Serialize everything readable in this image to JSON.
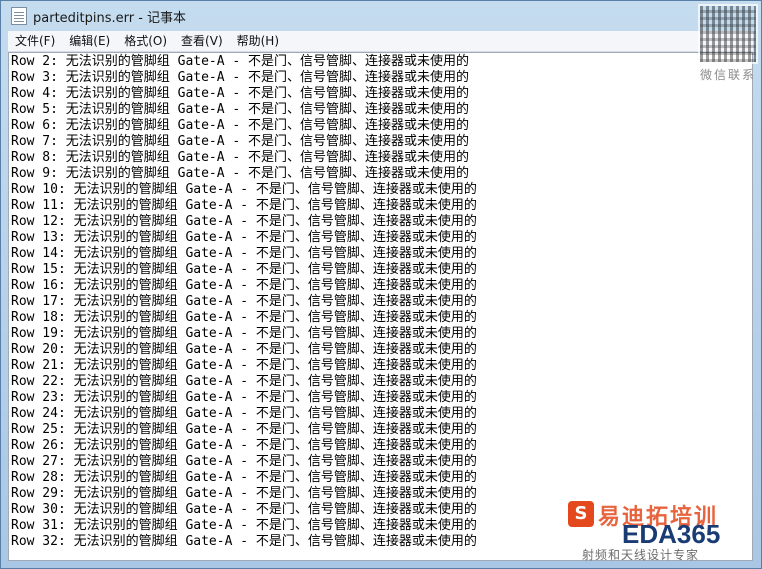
{
  "window": {
    "title": "parteditpins.err - 记事本"
  },
  "menu": [
    {
      "label": "文件(F)"
    },
    {
      "label": "编辑(E)"
    },
    {
      "label": "格式(O)"
    },
    {
      "label": "查看(V)"
    },
    {
      "label": "帮助(H)"
    }
  ],
  "lines": [
    "Row 2: 无法识别的管脚组 Gate-A - 不是门、信号管脚、连接器或未使用的",
    "Row 3: 无法识别的管脚组 Gate-A - 不是门、信号管脚、连接器或未使用的",
    "Row 4: 无法识别的管脚组 Gate-A - 不是门、信号管脚、连接器或未使用的",
    "Row 5: 无法识别的管脚组 Gate-A - 不是门、信号管脚、连接器或未使用的",
    "Row 6: 无法识别的管脚组 Gate-A - 不是门、信号管脚、连接器或未使用的",
    "Row 7: 无法识别的管脚组 Gate-A - 不是门、信号管脚、连接器或未使用的",
    "Row 8: 无法识别的管脚组 Gate-A - 不是门、信号管脚、连接器或未使用的",
    "Row 9: 无法识别的管脚组 Gate-A - 不是门、信号管脚、连接器或未使用的",
    "Row 10: 无法识别的管脚组 Gate-A - 不是门、信号管脚、连接器或未使用的",
    "Row 11: 无法识别的管脚组 Gate-A - 不是门、信号管脚、连接器或未使用的",
    "Row 12: 无法识别的管脚组 Gate-A - 不是门、信号管脚、连接器或未使用的",
    "Row 13: 无法识别的管脚组 Gate-A - 不是门、信号管脚、连接器或未使用的",
    "Row 14: 无法识别的管脚组 Gate-A - 不是门、信号管脚、连接器或未使用的",
    "Row 15: 无法识别的管脚组 Gate-A - 不是门、信号管脚、连接器或未使用的",
    "Row 16: 无法识别的管脚组 Gate-A - 不是门、信号管脚、连接器或未使用的",
    "Row 17: 无法识别的管脚组 Gate-A - 不是门、信号管脚、连接器或未使用的",
    "Row 18: 无法识别的管脚组 Gate-A - 不是门、信号管脚、连接器或未使用的",
    "Row 19: 无法识别的管脚组 Gate-A - 不是门、信号管脚、连接器或未使用的",
    "Row 20: 无法识别的管脚组 Gate-A - 不是门、信号管脚、连接器或未使用的",
    "Row 21: 无法识别的管脚组 Gate-A - 不是门、信号管脚、连接器或未使用的",
    "Row 22: 无法识别的管脚组 Gate-A - 不是门、信号管脚、连接器或未使用的",
    "Row 23: 无法识别的管脚组 Gate-A - 不是门、信号管脚、连接器或未使用的",
    "Row 24: 无法识别的管脚组 Gate-A - 不是门、信号管脚、连接器或未使用的",
    "Row 25: 无法识别的管脚组 Gate-A - 不是门、信号管脚、连接器或未使用的",
    "Row 26: 无法识别的管脚组 Gate-A - 不是门、信号管脚、连接器或未使用的",
    "Row 27: 无法识别的管脚组 Gate-A - 不是门、信号管脚、连接器或未使用的",
    "Row 28: 无法识别的管脚组 Gate-A - 不是门、信号管脚、连接器或未使用的",
    "Row 29: 无法识别的管脚组 Gate-A - 不是门、信号管脚、连接器或未使用的",
    "Row 30: 无法识别的管脚组 Gate-A - 不是门、信号管脚、连接器或未使用的",
    "Row 31: 无法识别的管脚组 Gate-A - 不是门、信号管脚、连接器或未使用的",
    "Row 32: 无法识别的管脚组 Gate-A - 不是门、信号管脚、连接器或未使用的"
  ],
  "watermark": {
    "qr_label": "微信联系",
    "logo_letter": "S",
    "brand_cn": "易迪拓培训",
    "brand_en": "EDA365",
    "tagline": "射频和天线设计专家"
  }
}
